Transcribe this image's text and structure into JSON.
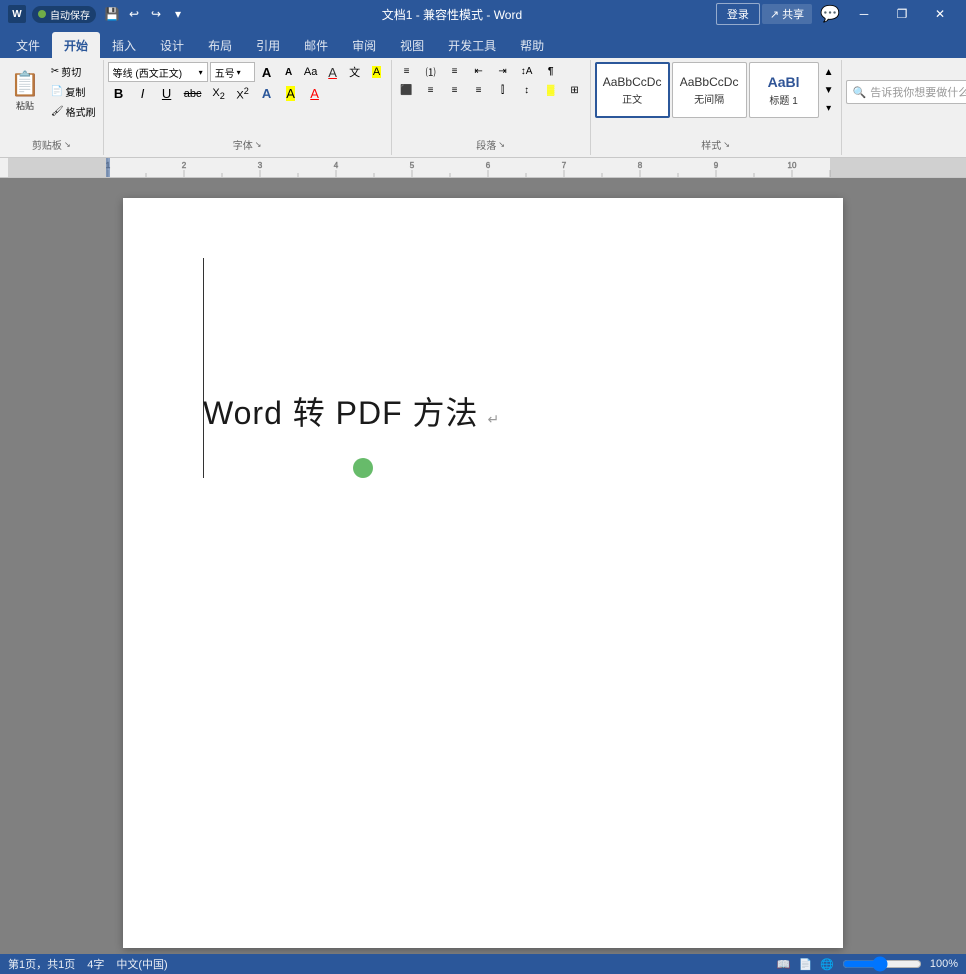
{
  "titleBar": {
    "autosave": "自动保存",
    "autosave_on": "●",
    "title": "文档1 - 兼容性模式 - Word",
    "login": "登录",
    "saveIcon": "💾",
    "undoIcon": "↩",
    "redoIcon": "↪",
    "customizeIcon": "▾",
    "minimizeIcon": "─",
    "restoreIcon": "❐",
    "closeIcon": "✕"
  },
  "ribbonTabs": [
    {
      "id": "file",
      "label": "文件",
      "active": false
    },
    {
      "id": "home",
      "label": "开始",
      "active": true
    },
    {
      "id": "insert",
      "label": "插入",
      "active": false
    },
    {
      "id": "design",
      "label": "设计",
      "active": false
    },
    {
      "id": "layout",
      "label": "布局",
      "active": false
    },
    {
      "id": "references",
      "label": "引用",
      "active": false
    },
    {
      "id": "mail",
      "label": "邮件",
      "active": false
    },
    {
      "id": "review",
      "label": "审阅",
      "active": false
    },
    {
      "id": "view",
      "label": "视图",
      "active": false
    },
    {
      "id": "devtools",
      "label": "开发工具",
      "active": false
    },
    {
      "id": "help",
      "label": "帮助",
      "active": false
    }
  ],
  "groups": {
    "clipboard": {
      "label": "剪贴板",
      "paste": "粘贴",
      "cut": "剪切",
      "copy": "复制",
      "format_painter": "格式刷"
    },
    "font": {
      "label": "字体",
      "font_name": "等线 (西文正文)",
      "font_size": "五号",
      "grow": "A",
      "shrink": "A",
      "change_case": "Aa",
      "clear": "A",
      "bold": "B",
      "italic": "I",
      "underline": "U",
      "strikethrough": "abc",
      "subscript": "X₂",
      "superscript": "X²",
      "font_color": "A",
      "highlight": "A",
      "text_effects": "A",
      "phonetic": "文"
    },
    "paragraph": {
      "label": "段落",
      "bullets": "≡",
      "numbering": "≡",
      "multilevel": "≡",
      "decrease_indent": "←≡",
      "increase_indent": "→≡",
      "sort": "↕",
      "show_marks": "¶",
      "align_left": "≡",
      "align_center": "≡",
      "align_right": "≡",
      "justify": "≡",
      "columns": "≡",
      "line_spacing": "↕",
      "shading": "🎨",
      "borders": "⊞"
    },
    "styles": {
      "label": "样式",
      "style1_preview": "AaBbCcDc",
      "style1_name": "正文",
      "style2_preview": "AaBbCcDc",
      "style2_name": "无间隔",
      "style3_preview": "AaBl",
      "style3_name": "标题 1"
    },
    "search": {
      "label": "",
      "placeholder": "告诉我你想要做什么",
      "icon": "🔍"
    },
    "editing": {
      "label": "",
      "icon": "🔍"
    }
  },
  "topRight": {
    "share_icon": "↗",
    "share_label": "共享",
    "comment_icon": "💬"
  },
  "document": {
    "title": "Word 转 PDF 方法",
    "paragraph_mark": "↵",
    "page": "第1页，共1页",
    "word_count": "4字",
    "language": "中文(中国)"
  },
  "status": {
    "page": "第1页，共1页",
    "words": "4字",
    "language": "中文(中国)"
  }
}
